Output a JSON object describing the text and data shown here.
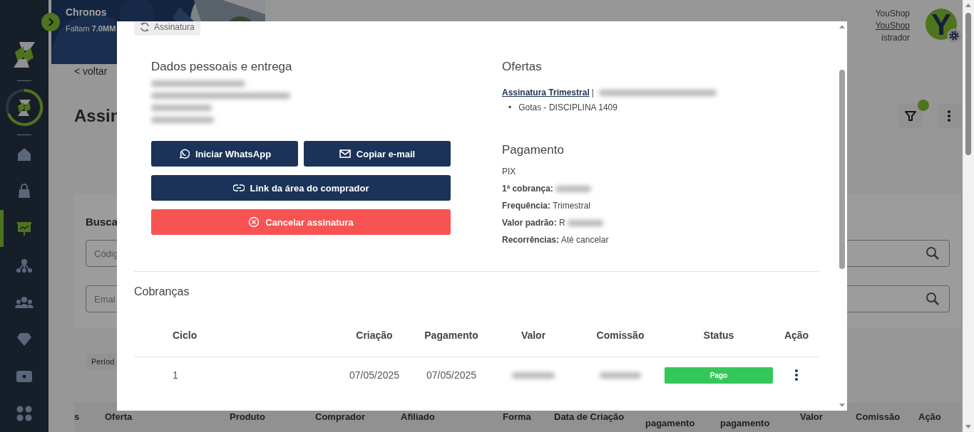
{
  "sidebar": {
    "items": [
      {
        "selected": false
      },
      {
        "selected": false
      },
      {
        "selected": true
      },
      {
        "selected": false
      },
      {
        "selected": false
      },
      {
        "selected": false
      },
      {
        "selected": false
      },
      {
        "selected": false
      }
    ]
  },
  "banner": {
    "title": "Chronos",
    "subtitle": "Faltam **7.0MM**"
  },
  "user": {
    "name": "YouShop",
    "store": "YouShop",
    "role": "istrador",
    "avatar_letter": "Y"
  },
  "page": {
    "back": "< voltar",
    "title": "Assin",
    "filter_active": true,
    "search_title": "Busca",
    "fields": [
      {
        "placeholder": "Códig"
      },
      {
        "placeholder": "Emai"
      }
    ],
    "period": "Períod",
    "table_headers": [
      "s",
      "Oferta",
      "Produto",
      "Comprador",
      "Afiliado",
      "Forma",
      "Data de Criação",
      "pagamento",
      "pagamento",
      "Valor",
      "Comissão",
      "Ação"
    ]
  },
  "modal": {
    "chip": "Assinatura",
    "personal": {
      "title": "Dados pessoais e entrega"
    },
    "buttons": [
      {
        "label": "Iniciar WhatsApp",
        "kind": "whatsapp"
      },
      {
        "label": "Copiar e-mail",
        "kind": "email"
      },
      {
        "label": "Link da área do comprador",
        "kind": "link"
      },
      {
        "label": "Cancelar assinatura",
        "kind": "cancel"
      }
    ],
    "offers": {
      "title": "Ofertas",
      "link": "Assinatura Trimestral",
      "separator": "|",
      "items": [
        {
          "bullet": "•",
          "text": "Gotas - DISCIPLINA 1409"
        }
      ]
    },
    "payment": {
      "title": "Pagamento",
      "method": "PIX",
      "rows": [
        {
          "label": "1ª cobrança:",
          "blurred": true
        },
        {
          "label": "Frequência:",
          "value": "Trimestral",
          "blurred": false
        },
        {
          "label": "Valor padrão:",
          "value": "R",
          "blurred": true
        },
        {
          "label": "Recorrências:",
          "value": "Até cancelar",
          "blurred": false
        }
      ]
    },
    "charges": {
      "title": "Cobranças",
      "columns": [
        "Ciclo",
        "Criação",
        "Pagamento",
        "Valor",
        "Comissão",
        "Status",
        "Ação"
      ],
      "rows": [
        {
          "cycle": "1",
          "created": "07/05/2025",
          "paid": "07/05/2025",
          "status": {
            "label": "Pago",
            "kind": "paid"
          }
        }
      ]
    }
  }
}
